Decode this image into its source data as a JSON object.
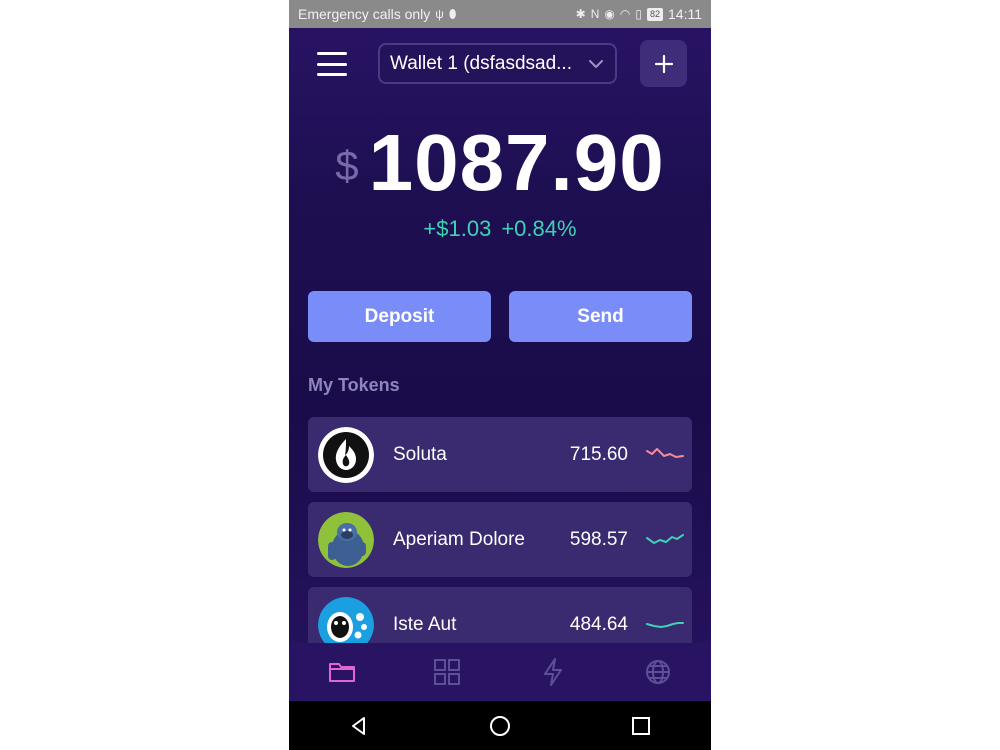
{
  "status_bar": {
    "carrier_text": "Emergency calls only",
    "battery": "82",
    "time": "14:11"
  },
  "header": {
    "menu_icon": "hamburger-menu-icon",
    "wallet_label": "Wallet 1 (dsfasdsad...",
    "add_icon": "plus-icon"
  },
  "balance": {
    "currency_symbol": "$",
    "amount": "1087.90",
    "change_amount": "+$1.03",
    "change_percent": "+0.84%"
  },
  "actions": {
    "deposit_label": "Deposit",
    "send_label": "Send"
  },
  "tokens_section": {
    "title": "My Tokens",
    "items": [
      {
        "name": "Soluta",
        "value": "715.60",
        "trend": "down",
        "trend_color": "#f48a9a"
      },
      {
        "name": "Aperiam Dolore",
        "value": "598.57",
        "trend": "up",
        "trend_color": "#3ed2b4"
      },
      {
        "name": "Iste Aut",
        "value": "484.64",
        "trend": "up",
        "trend_color": "#3ed2b4"
      }
    ]
  },
  "bottom_nav": {
    "items": [
      {
        "icon": "folder-icon",
        "active": true
      },
      {
        "icon": "grid-icon",
        "active": false
      },
      {
        "icon": "lightning-icon",
        "active": false
      },
      {
        "icon": "globe-icon",
        "active": false
      }
    ]
  },
  "colors": {
    "background": "#1e0f52",
    "accent_button": "#7a8cf8",
    "positive": "#3ed2b4",
    "negative": "#f48a9a",
    "active_nav": "#e067d0"
  }
}
